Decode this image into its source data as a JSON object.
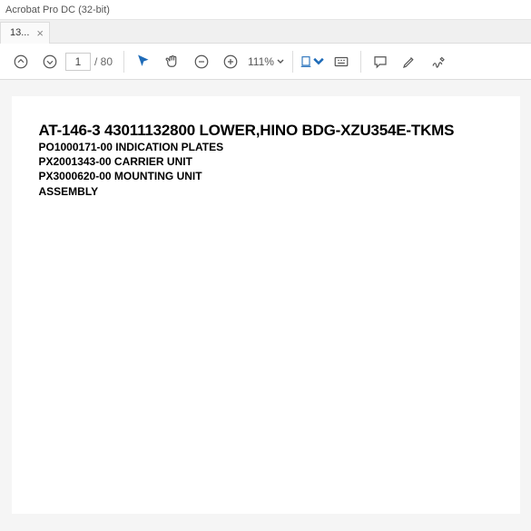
{
  "window": {
    "title": "Acrobat Pro DC (32-bit)"
  },
  "tab": {
    "label": "13...",
    "close": "×"
  },
  "toolbar": {
    "page_current": "1",
    "page_total": "/ 80",
    "zoom": "111%"
  },
  "document": {
    "title": "AT-146-3 43011132800 LOWER,HINO BDG-XZU354E-TKMS",
    "lines": [
      "PO1000171-00 INDICATION PLATES",
      "PX2001343-00 CARRIER UNIT",
      "PX3000620-00 MOUNTING UNIT",
      "ASSEMBLY"
    ]
  }
}
